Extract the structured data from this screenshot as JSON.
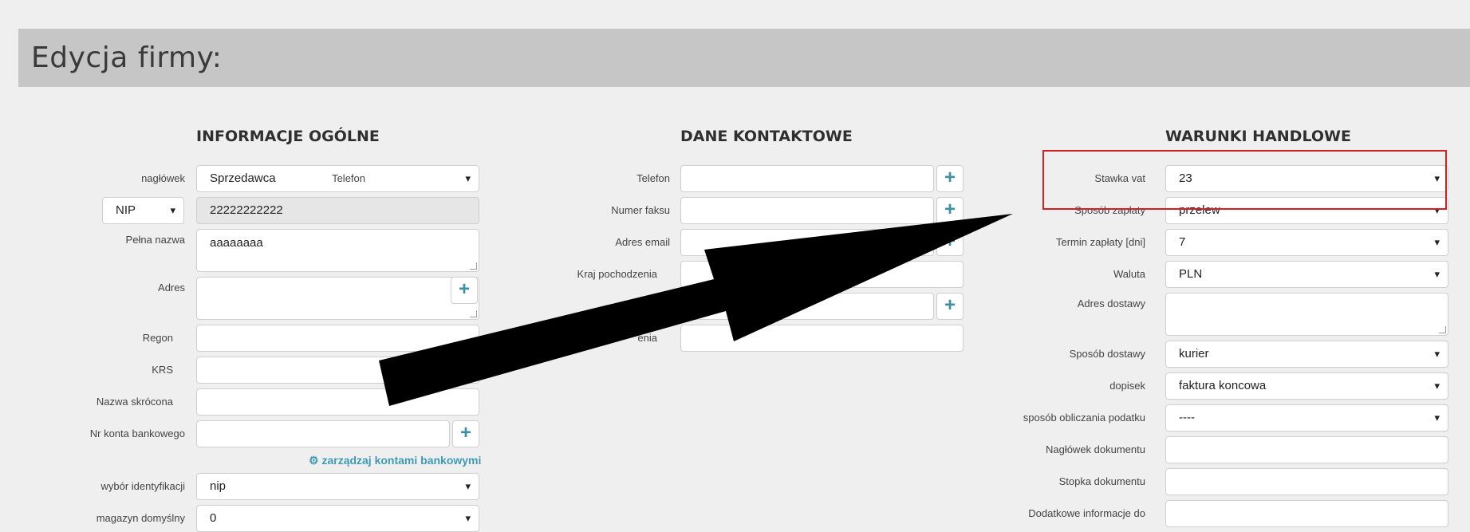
{
  "page": {
    "title": "Edycja firmy:"
  },
  "general": {
    "title": "INFORMACJE OGÓLNE",
    "naglowek_label": "nagłówek",
    "naglowek_value": "Sprzedawca",
    "id_type_value": "NIP",
    "nip_value": "22222222222",
    "pelna_nazwa_label": "Pełna nazwa",
    "pelna_nazwa_value": "aaaaaaaa",
    "adres_label": "Adres",
    "regon_label": "Regon",
    "krs_label": "KRS",
    "nazwa_skrocona_label": "Nazwa skrócona",
    "konto_label": "Nr konta bankowego",
    "manage_accounts_link": "zarządzaj kontami bankowymi",
    "wybor_identyfikacji_label": "wybór identyfikacji",
    "wybor_identyfikacji_value": "nip",
    "magazyn_label": "magazyn domyślny",
    "magazyn_value": "0"
  },
  "contact": {
    "title": "DANE KONTAKTOWE",
    "telefon_label": "Telefon",
    "fax_label": "Numer faksu",
    "email_label": "Adres email",
    "kraj_label": "Kraj pochodzenia",
    "partial_label": "enia"
  },
  "trade": {
    "title": "WARUNKI HANDLOWE",
    "vat_label": "Stawka vat",
    "vat_value": "23",
    "platnosc_label": "Sposób zapłaty",
    "platnosc_value": "przelew",
    "termin_label": "Termin zapłaty [dni]",
    "termin_value": "7",
    "waluta_label": "Waluta",
    "waluta_value": "PLN",
    "adres_dostawy_label": "Adres dostawy",
    "dostawa_label": "Sposób dostawy",
    "dostawa_value": "kurier",
    "dopisek_label": "dopisek",
    "dopisek_value": "faktura koncowa",
    "podatek_label": "sposób obliczania podatku",
    "podatek_value": "----",
    "naglowek_dok_label": "Nagłówek dokumentu",
    "stopka_label": "Stopka dokumentu",
    "dodatkowe_label": "Dodatkowe informacje do"
  },
  "icons": {
    "plus": "plus-icon",
    "gears": "gears-icon",
    "dropdown": "caret-down-icon"
  },
  "colors": {
    "accent": "#3e9bb3",
    "highlight": "#d21f1f",
    "header": "#c6c6c6"
  }
}
